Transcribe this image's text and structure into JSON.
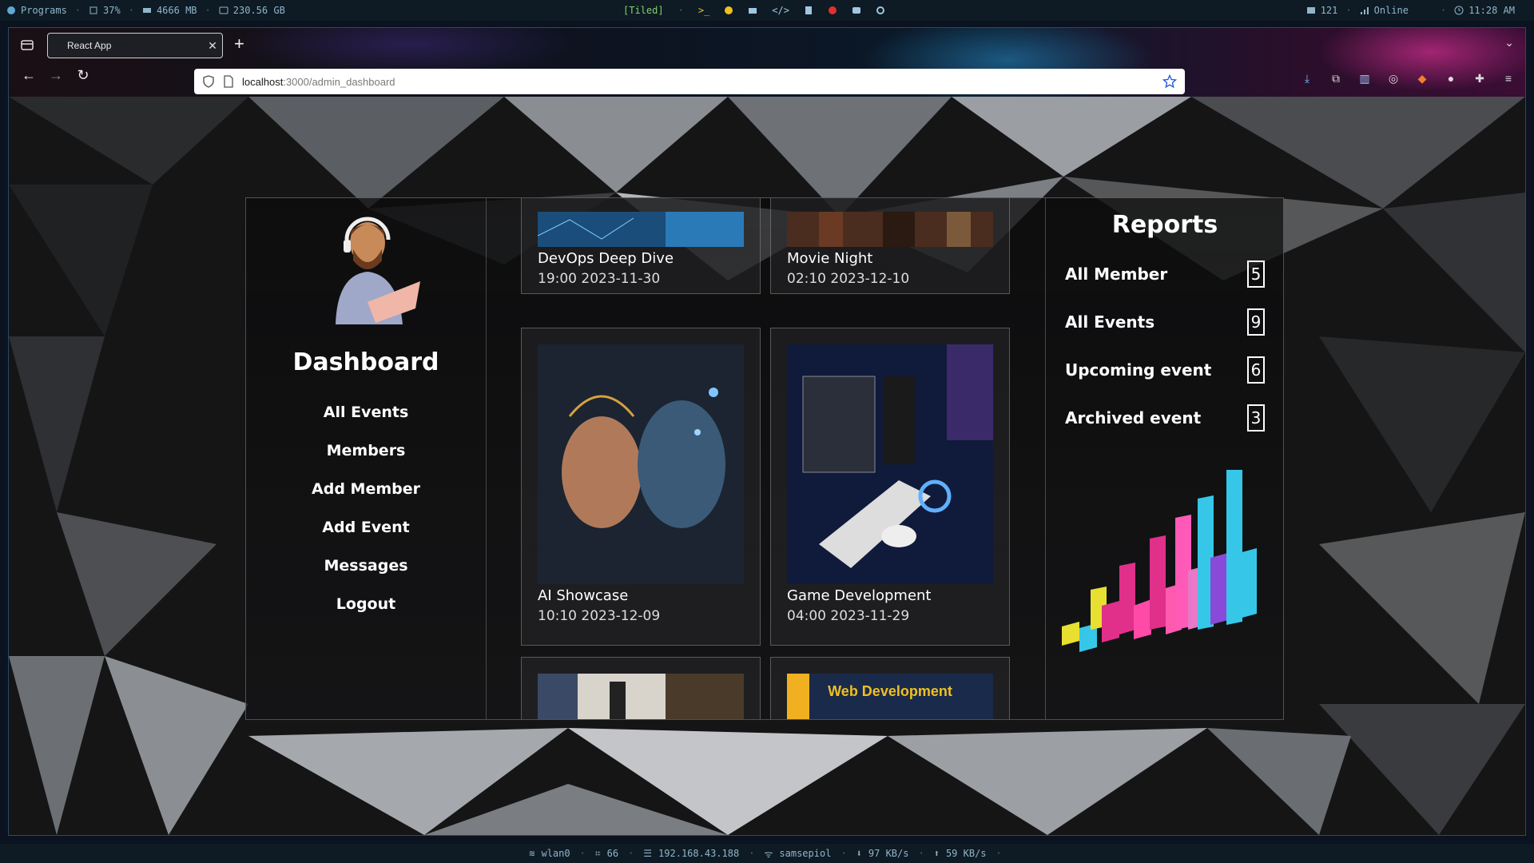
{
  "wm_top": {
    "programs": "Programs",
    "cpu": "37%",
    "ram": "4666 MB",
    "disk": "230.56 GB",
    "layout": "[Tiled]",
    "updates": "121",
    "network": "Online",
    "clock": "11:28 AM"
  },
  "wm_bottom": {
    "iface": "wlan0",
    "signal": "66",
    "ip": "192.168.43.188",
    "ssid": "samsepiol",
    "down": "97 KB/s",
    "up": "59 KB/s"
  },
  "browser": {
    "tab_title": "React App",
    "url_host": "localhost",
    "url_path": ":3000/admin_dashboard"
  },
  "sidebar": {
    "title": "Dashboard",
    "items": [
      {
        "label": "All Events"
      },
      {
        "label": "Members"
      },
      {
        "label": "Add Member"
      },
      {
        "label": "Add Event"
      },
      {
        "label": "Messages"
      },
      {
        "label": "Logout"
      }
    ]
  },
  "events": [
    {
      "title": "DevOps Deep Dive",
      "time": "19:00 2023-11-30"
    },
    {
      "title": "Movie Night",
      "time": "02:10 2023-12-10"
    },
    {
      "title": "AI Showcase",
      "time": "10:10 2023-12-09"
    },
    {
      "title": "Game Development",
      "time": "04:00 2023-11-29"
    },
    {
      "title": "",
      "time": "",
      "thumb_text": ""
    },
    {
      "title": "",
      "time": "",
      "thumb_text": "Web Development"
    }
  ],
  "reports": {
    "title": "Reports",
    "rows": [
      {
        "label": "All Member",
        "count": "5"
      },
      {
        "label": "All Events",
        "count": "9"
      },
      {
        "label": "Upcoming event",
        "count": "6"
      },
      {
        "label": "Archived event",
        "count": "3"
      }
    ]
  },
  "colors": {
    "bar_pink": "#e0308a",
    "bar_cyan": "#36c7e8",
    "bar_yellow": "#e8e030",
    "bar_purple": "#8a4ad8"
  }
}
